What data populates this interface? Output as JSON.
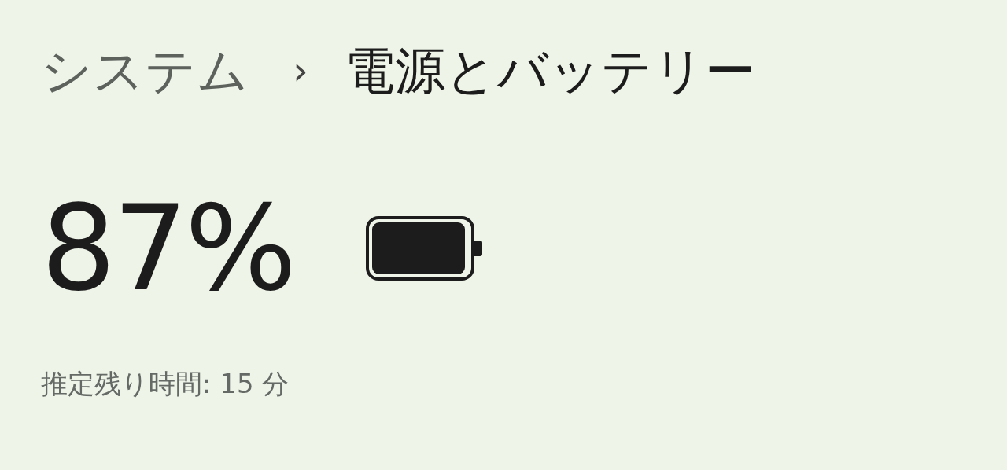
{
  "breadcrumb": [
    {
      "label": "システム",
      "current": false
    },
    {
      "label": "電源とバッテリー",
      "current": true
    }
  ],
  "separator": "›",
  "battery": {
    "percent": "87%",
    "estimate": "推定残り時間: 15 分"
  }
}
